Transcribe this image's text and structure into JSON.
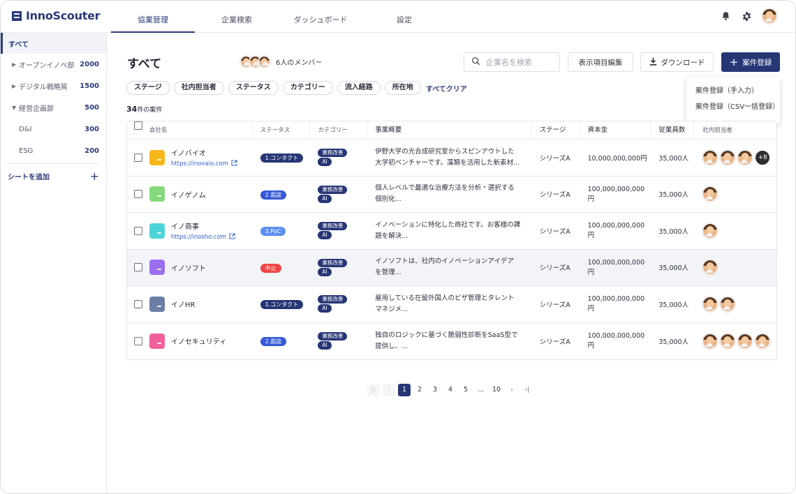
{
  "app": {
    "logo_text": "InnoScouter"
  },
  "nav": {
    "tabs": [
      "協業管理",
      "企業検索",
      "ダッシュボード",
      "設定"
    ]
  },
  "sidebar": {
    "items": [
      {
        "label": "すべて",
        "count": ""
      },
      {
        "label": "オープンイノベ部",
        "count": "2000"
      },
      {
        "label": "デジタル戦略質",
        "count": "1500"
      },
      {
        "label": "経営企画部",
        "count": "500"
      },
      {
        "label": "D&I",
        "count": "300"
      },
      {
        "label": "ESG",
        "count": "200"
      }
    ],
    "add_sheet": "シートを追加"
  },
  "header": {
    "title": "すべて",
    "members_label": "6人のメンバー",
    "search_placeholder": "企業名を検索",
    "edit_columns": "表示項目編集",
    "download": "ダウンロード",
    "add_case": "案件登録"
  },
  "dropdown": {
    "items": [
      "案件登録（手入力）",
      "案件登録（CSV一括登録）"
    ]
  },
  "filters": {
    "chips": [
      "ステージ",
      "社内担当者",
      "ステータス",
      "カテゴリー",
      "流入経路",
      "所在地"
    ],
    "clear_all": "すべてクリア"
  },
  "case_count": {
    "number": "34",
    "unit": "件の案件"
  },
  "table": {
    "headers": [
      "会社名",
      "ステータス",
      "カテゴリー",
      "事業概要",
      "ステージ",
      "資本金",
      "従業員数",
      "社内担当者"
    ],
    "rows": [
      {
        "name": "イノバイオ",
        "url": "https://inovaio.com",
        "logo_color": "#f7b718",
        "status": "1.コンタクト",
        "status_color": "#263675",
        "cat1": "業務改善",
        "cat2": "AI",
        "desc1": "伊野大学の光合成研究室からスピンアウトした",
        "desc2": "大学初ベンチャーです。藻類を活用した新素材...",
        "stage": "シリーズA",
        "capital": "10,000,000,000円",
        "employees": "35,000人",
        "more": "+8"
      },
      {
        "name": "イノゲノム",
        "url": "",
        "logo_color": "#86d97a",
        "status": "2.面談",
        "status_color": "#3558d6",
        "cat1": "業務改善",
        "cat2": "AI",
        "desc1": "個人レベルで最適な治療方法を分析・選択する",
        "desc2": "個別化...",
        "stage": "シリーズA",
        "capital": "100,000,000,000円",
        "employees": "35,000人"
      },
      {
        "name": "イノ商事",
        "url": "https://inosho.com",
        "logo_color": "#4dd4d8",
        "status": "3.PoC",
        "status_color": "#5b8ff0",
        "cat1": "業務改善",
        "cat2": "AI",
        "desc1": "イノベーションに特化した商社です。お客様の課",
        "desc2": "題を解決...",
        "stage": "シリーズA",
        "capital": "100,000,000,000円",
        "employees": "35,000人"
      },
      {
        "name": "イノソフト",
        "url": "",
        "logo_color": "#9b6ff0",
        "status": "中止",
        "status_color": "#ef4444",
        "cat1": "業務改善",
        "cat2": "AI",
        "desc1": "イノソフトは、社内のイノベーションアイデア",
        "desc2": "を管理...",
        "stage": "シリーズA",
        "capital": "100,000,000,000円",
        "employees": "35,000人"
      },
      {
        "name": "イノHR",
        "url": "",
        "logo_color": "#6b7fa6",
        "status": "1.コンタクト",
        "status_color": "#263675",
        "cat1": "業務改善",
        "cat2": "AI",
        "desc1": "雇用している在留外国人のビザ管理とタレント",
        "desc2": "マネジメ...",
        "stage": "シリーズA",
        "capital": "100,000,000,000円",
        "employees": "35,000人"
      },
      {
        "name": "イノセキュリティ",
        "url": "",
        "logo_color": "#f2609c",
        "status": "2.面談",
        "status_color": "#3558d6",
        "cat1": "業務改善",
        "cat2": "AI",
        "desc1": "独自のロジックに基づく脆弱性診断をSaaS型で",
        "desc2": "提供し、...",
        "stage": "シリーズA",
        "capital": "100,000,000,000円",
        "employees": "35,000人"
      }
    ]
  },
  "pagination": {
    "pages": [
      "1",
      "2",
      "3",
      "4",
      "5",
      "...",
      "10"
    ],
    "current": "1"
  }
}
